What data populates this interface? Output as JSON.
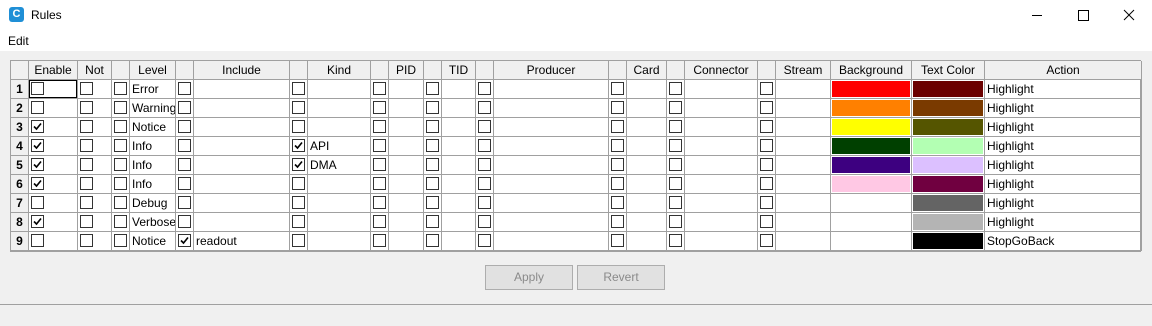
{
  "window": {
    "title": "Rules",
    "icon": "app-logo-icon"
  },
  "menu": {
    "items": [
      "Edit"
    ]
  },
  "columns": [
    "Enable",
    "Not",
    "Level",
    "Include",
    "Kind",
    "PID",
    "TID",
    "Producer",
    "Card",
    "Connector",
    "Stream",
    "Background",
    "Text Color",
    "Action"
  ],
  "rows": [
    {
      "num": "1",
      "enable": false,
      "not": false,
      "level": "Error",
      "include": "",
      "kind_checked": false,
      "kind": "",
      "background": "#ff0000",
      "text_color": "#6b0000",
      "action": "Highlight"
    },
    {
      "num": "2",
      "enable": false,
      "not": false,
      "level": "Warning",
      "include": "",
      "kind_checked": false,
      "kind": "",
      "background": "#ff8000",
      "text_color": "#7a3a00",
      "action": "Highlight"
    },
    {
      "num": "3",
      "enable": true,
      "not": false,
      "level": "Notice",
      "include": "",
      "kind_checked": false,
      "kind": "",
      "background": "#ffff00",
      "text_color": "#555500",
      "action": "Highlight"
    },
    {
      "num": "4",
      "enable": true,
      "not": false,
      "level": "Info",
      "include": "",
      "kind_checked": true,
      "kind": "API",
      "background": "#004000",
      "text_color": "#b3ffb3",
      "action": "Highlight"
    },
    {
      "num": "5",
      "enable": true,
      "not": false,
      "level": "Info",
      "include": "",
      "kind_checked": true,
      "kind": "DMA",
      "background": "#3d0080",
      "text_color": "#dcc0ff",
      "action": "Highlight"
    },
    {
      "num": "6",
      "enable": true,
      "not": false,
      "level": "Info",
      "include": "",
      "kind_checked": false,
      "kind": "",
      "background": "#ffc8e4",
      "text_color": "#700040",
      "action": "Highlight"
    },
    {
      "num": "7",
      "enable": false,
      "not": false,
      "level": "Debug",
      "include": "",
      "kind_checked": false,
      "kind": "",
      "background": "",
      "text_color": "#646464",
      "action": "Highlight"
    },
    {
      "num": "8",
      "enable": true,
      "not": false,
      "level": "Verbose",
      "include": "",
      "kind_checked": false,
      "kind": "",
      "background": "",
      "text_color": "#b4b4b4",
      "action": "Highlight"
    },
    {
      "num": "9",
      "enable": false,
      "not": false,
      "level": "Notice",
      "include_checked": true,
      "include": "readout",
      "kind_checked": false,
      "kind": "",
      "background": "",
      "text_color": "#000000",
      "action": "StopGoBack"
    }
  ],
  "buttons": {
    "apply": "Apply",
    "revert": "Revert"
  }
}
